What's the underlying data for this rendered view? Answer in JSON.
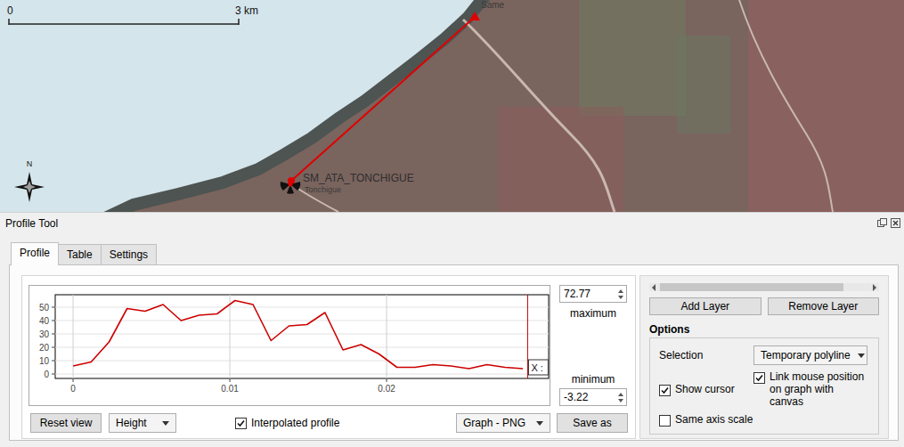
{
  "map": {
    "scale_bar": {
      "start": "0",
      "end": "3 km"
    },
    "north": "N",
    "station": "SM_ATA_TONCHIGUE",
    "places": [
      {
        "text": "Same"
      },
      {
        "text": "Tonchigue"
      }
    ]
  },
  "panel": {
    "title": "Profile Tool",
    "tabs": [
      {
        "label": "Profile",
        "selected": true
      },
      {
        "label": "Table",
        "selected": false
      },
      {
        "label": "Settings",
        "selected": false
      }
    ],
    "chart": {
      "y_ticks": [
        "0",
        "10",
        "20",
        "30",
        "40",
        "50"
      ],
      "x_ticks": [
        "0",
        "0.01",
        "0.02"
      ],
      "series": [
        {
          "name": "Profile",
          "color": "#cc0000",
          "distance_end": 0.0287,
          "values": [
            6,
            9,
            24,
            49,
            47,
            52,
            40,
            44,
            45,
            55,
            52,
            25,
            36,
            37,
            46,
            18,
            22,
            15,
            5,
            5,
            7,
            6,
            4,
            7,
            5,
            4
          ]
        }
      ],
      "cursor": {
        "position": 0.029,
        "label": "X :"
      }
    },
    "maximum": {
      "value": "72.77",
      "label": "maximum"
    },
    "minimum": {
      "value": "-3.22",
      "label": "minimum"
    },
    "reset_button": "Reset view",
    "mode_select": "Height",
    "interpolated": {
      "label": "Interpolated profile",
      "checked": true
    },
    "format_select": "Graph - PNG",
    "save_button": "Save as",
    "layer_buttons": [
      "Add Layer",
      "Remove Layer"
    ],
    "options": {
      "title": "Options",
      "selection": {
        "label": "Selection",
        "value": "Temporary polyline"
      },
      "checkboxes": [
        {
          "label": "Show cursor",
          "checked": true
        },
        {
          "label": "Link mouse position on graph with canvas",
          "checked": true
        },
        {
          "label": "Same axis scale",
          "checked": false
        }
      ]
    }
  }
}
